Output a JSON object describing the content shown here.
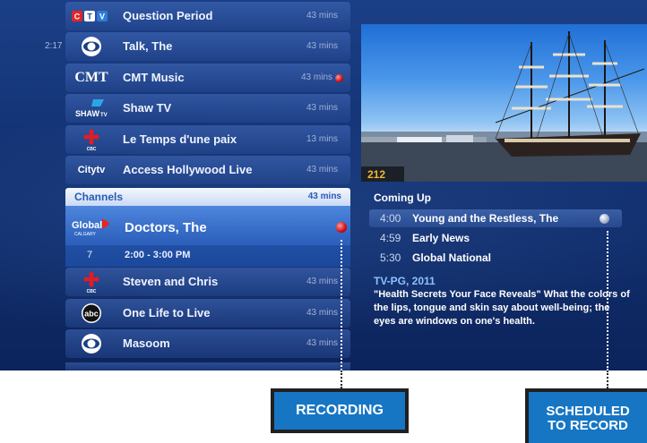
{
  "guide": {
    "left_time": "2:17",
    "rows_above": [
      {
        "logo": "CTV",
        "title": "Question Period",
        "duration": "43 mins"
      },
      {
        "logo": "cbs-eye",
        "title": "Talk, The",
        "duration": "43 mins"
      },
      {
        "logo": "CMT",
        "title": "CMT Music",
        "duration": "43 mins"
      },
      {
        "logo": "SHAW TV",
        "title": "Shaw TV",
        "duration": "43 mins"
      },
      {
        "logo": "cbc-gem",
        "title": "Le Temps d'une paix",
        "duration": "13 mins"
      },
      {
        "logo": "Citytv",
        "title": "Access Hollywood Live",
        "duration": "43 mins"
      }
    ],
    "channels_header": {
      "label": "Channels",
      "duration": "43 mins"
    },
    "selected": {
      "logo": "Global",
      "logo_sub": "CALGARY",
      "title": "Doctors, The",
      "channel_number": "7",
      "time_slot": "2:00 - 3:00 PM"
    },
    "rows_below": [
      {
        "logo": "cbc-gem",
        "title": "Steven and Chris",
        "duration": "43 mins"
      },
      {
        "logo": "abc",
        "title": "One Life to Live",
        "duration": "43 mins"
      },
      {
        "logo": "cbs-eye",
        "title": "Masoom",
        "duration": "43 mins"
      }
    ]
  },
  "preview": {
    "channel_number": "212"
  },
  "info": {
    "coming_up_label": "Coming Up",
    "coming_up": [
      {
        "time": "4:00",
        "title": "Young and the Restless, The"
      },
      {
        "time": "4:59",
        "title": "Early News"
      },
      {
        "time": "5:30",
        "title": "Global National"
      }
    ],
    "rating": "TV-PG, 2011",
    "description": "\"Health Secrets Your Face Reveals\" What the colors of the lips, tongue and skin say about well-being; the eyes are windows on one's health."
  },
  "callouts": {
    "recording": "RECORDING",
    "scheduled_line1": "SCHEDULED",
    "scheduled_line2": "TO RECORD"
  },
  "colors": {
    "callout_blue": "#1776c4",
    "record_red": "#d10e0e",
    "selected_blue": "#2f63bf"
  }
}
